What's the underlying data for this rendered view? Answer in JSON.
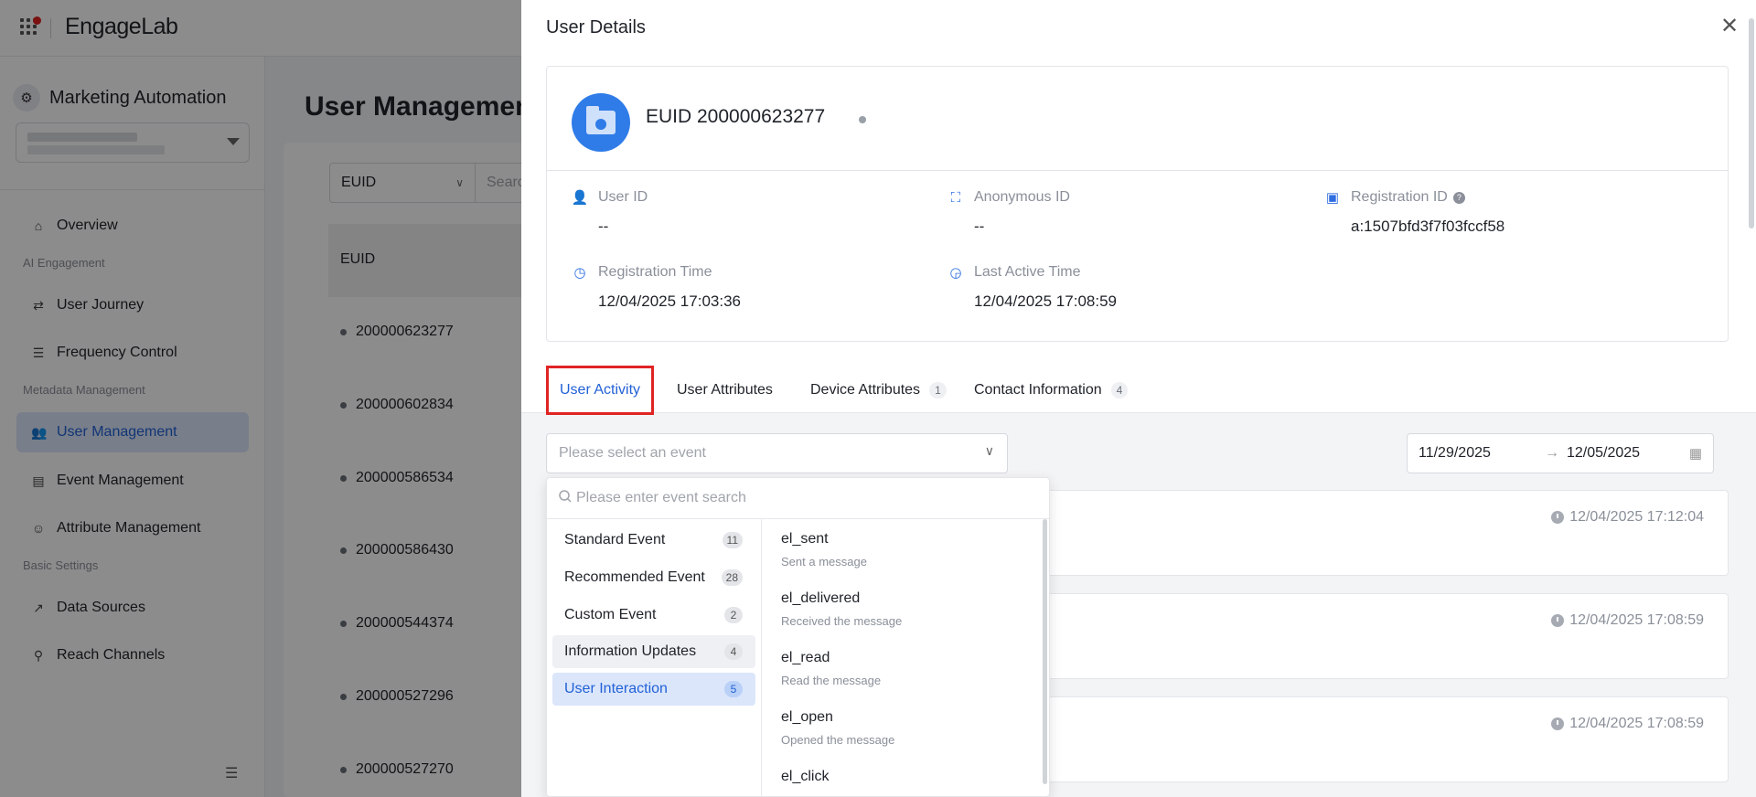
{
  "brand": "EngageLab",
  "sidebar": {
    "app_title": "Marketing Automation",
    "items": [
      {
        "label": "Overview"
      },
      {
        "group": "AI Engagement"
      },
      {
        "label": "User Journey"
      },
      {
        "label": "Frequency Control"
      },
      {
        "group": "Metadata Management"
      },
      {
        "label": "User Management"
      },
      {
        "label": "Event Management"
      },
      {
        "label": "Attribute Management"
      },
      {
        "group": "Basic Settings"
      },
      {
        "label": "Data Sources"
      },
      {
        "label": "Reach Channels"
      }
    ]
  },
  "main": {
    "title": "User Managemen",
    "filter_select": "EUID",
    "filter_placeholder": "Searc",
    "column_header": "EUID",
    "rows": [
      "200000623277",
      "200000602834",
      "200000586534",
      "200000586430",
      "200000544374",
      "200000527296",
      "200000527270"
    ]
  },
  "drawer": {
    "title": "User Details",
    "close_icon": "close-icon",
    "user": {
      "euid": "EUID 200000623277",
      "fields": [
        {
          "label": "User ID",
          "value": "--",
          "icon": "user-icon"
        },
        {
          "label": "Anonymous ID",
          "value": "--",
          "icon": "anonymous-icon"
        },
        {
          "label": "Registration ID",
          "value": "a:1507bfd3f7f03fccf58",
          "icon": "device-icon",
          "help": "?"
        },
        {
          "label": "Registration Time",
          "value": "12/04/2025 17:03:36",
          "icon": "clock-icon"
        },
        {
          "label": "Last Active Time",
          "value": "12/04/2025 17:08:59",
          "icon": "clock-icon"
        }
      ]
    },
    "tabs": [
      {
        "label": "User Activity"
      },
      {
        "label": "User Attributes"
      },
      {
        "label": "Device Attributes",
        "count": "1"
      },
      {
        "label": "Contact Information",
        "count": "4"
      }
    ],
    "event_select_placeholder": "Please select an event",
    "date_start": "11/29/2025",
    "date_end": "12/05/2025",
    "activity_times": [
      "12/04/2025 17:12:04",
      "12/04/2025 17:08:59",
      "12/04/2025 17:08:59"
    ],
    "dropdown": {
      "search_placeholder": "Please enter event search",
      "categories": [
        {
          "label": "Standard Event",
          "count": "11"
        },
        {
          "label": "Recommended Event",
          "count": "28"
        },
        {
          "label": "Custom Event",
          "count": "2"
        },
        {
          "label": "Information Updates",
          "count": "4"
        },
        {
          "label": "User Interaction",
          "count": "5"
        }
      ],
      "events": [
        {
          "name": "el_sent",
          "desc": "Sent a message"
        },
        {
          "name": "el_delivered",
          "desc": "Received the message"
        },
        {
          "name": "el_read",
          "desc": "Read the message"
        },
        {
          "name": "el_open",
          "desc": "Opened the message"
        },
        {
          "name": "el_click",
          "desc": ""
        }
      ]
    }
  },
  "colors": {
    "accent": "#2261d6",
    "highlight_border": "#e02424",
    "avatar": "#2f7ce8"
  }
}
